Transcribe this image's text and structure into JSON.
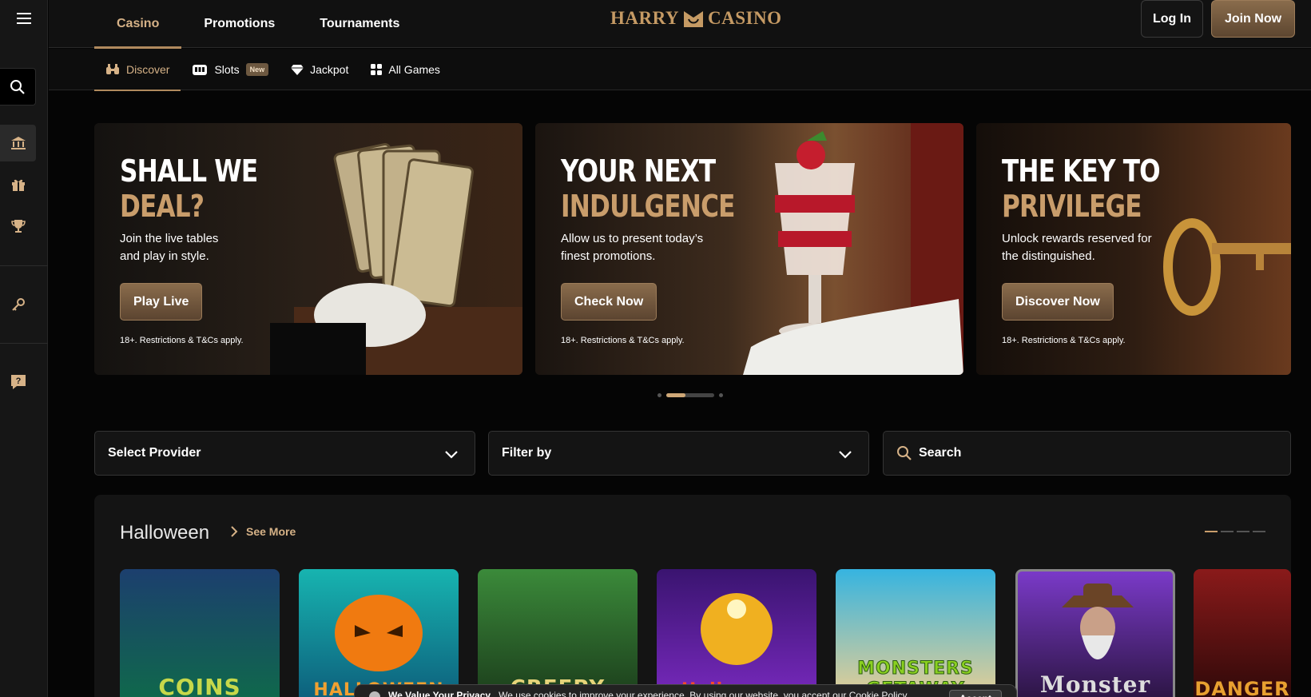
{
  "header": {
    "nav": [
      "Casino",
      "Promotions",
      "Tournaments"
    ],
    "active_tab": "Casino",
    "logo_left": "HARRY",
    "logo_right": "CASINO",
    "login": "Log In",
    "join": "Join Now"
  },
  "subnav": {
    "items": [
      {
        "label": "Discover",
        "icon": "binoculars-icon"
      },
      {
        "label": "Slots",
        "icon": "slot-machine-icon",
        "badge": "New"
      },
      {
        "label": "Jackpot",
        "icon": "diamond-icon"
      },
      {
        "label": "All Games",
        "icon": "grid-icon"
      }
    ]
  },
  "sidebar": {
    "icons": [
      "menu-icon",
      "search-icon",
      "bank-icon",
      "gift-icon",
      "trophy-icon",
      "key-icon",
      "help-icon"
    ]
  },
  "hero": [
    {
      "title_line1": "SHALL WE",
      "title_line2": "DEAL?",
      "desc": "Join the live tables and play in style.",
      "cta": "Play Live",
      "legal": "18+. Restrictions & T&Cs apply."
    },
    {
      "title_line1": "YOUR NEXT",
      "title_line2": "INDULGENCE",
      "desc": "Allow us to present today’s finest promotions.",
      "cta": "Check Now",
      "legal": "18+. Restrictions & T&Cs apply."
    },
    {
      "title_line1": "THE KEY TO",
      "title_line2": "PRIVILEGE",
      "desc": "Unlock rewards reserved for the distinguished.",
      "cta": "Discover Now",
      "legal": "18+. Restrictions & T&Cs apply."
    }
  ],
  "filters": {
    "provider": "Select Provider",
    "filter": "Filter by",
    "search": "Search"
  },
  "section": {
    "title": "Halloween",
    "see_more": "See More",
    "games": [
      {
        "name": "COINS",
        "bg": "#1f5a8a"
      },
      {
        "name": "HALLOWEEN",
        "bg": "#15a2a0"
      },
      {
        "name": "CREEPY",
        "bg": "#2e6a2c"
      },
      {
        "name": "Halloween",
        "bg": "#6a2cb0"
      },
      {
        "name": "MONSTERS GETAWAY",
        "bg": "#2aa9d8"
      },
      {
        "name": "Monster",
        "bg": "#5b2d8f"
      },
      {
        "name": "DANGER",
        "bg": "#7a1a1a"
      }
    ]
  },
  "cookie": {
    "title": "We Value Your Privacy",
    "text": "We use cookies to improve your experience. By using our website, you accept our Cookie Policy.",
    "accept": "Accept"
  },
  "colors": {
    "accent": "#c99d6b",
    "background": "#050505"
  }
}
